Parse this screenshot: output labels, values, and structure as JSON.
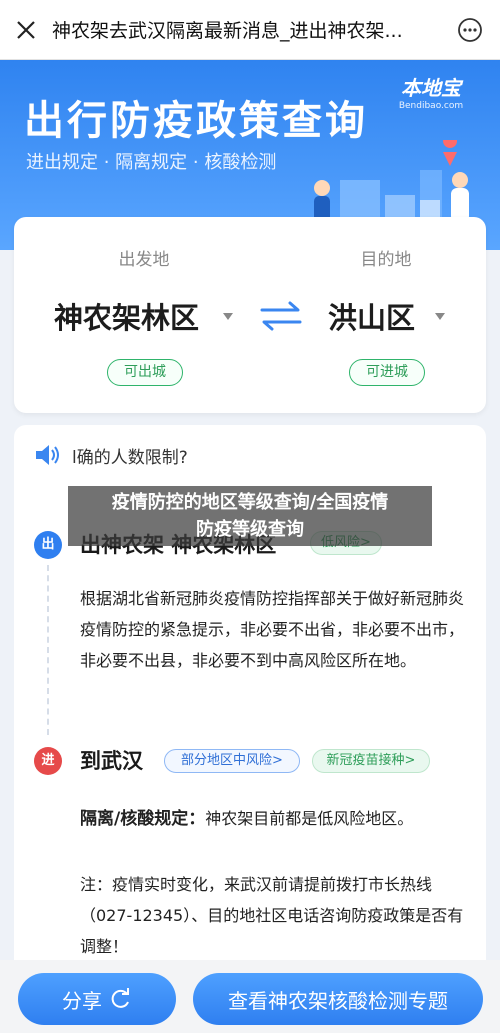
{
  "topbar": {
    "title": "神农架去武汉隔离最新消息_进出神农架..."
  },
  "hero": {
    "heading": "出行防疫政策查询",
    "subheading": "进出规定 · 隔离规定 · 核酸检测",
    "brand_cn": "本地宝",
    "brand_en": "Bendibao.com"
  },
  "route": {
    "from_label": "出发地",
    "to_label": "目的地",
    "from_city": "神农架林区",
    "to_city": "洪山区",
    "from_status": "可出城",
    "to_status": "可进城"
  },
  "notice": {
    "text": "l确的人数限制?"
  },
  "overlay": {
    "line1": "疫情防控的地区等级查询/全国疫情",
    "line2": "防疫等级查询"
  },
  "exit": {
    "badge": "出",
    "title": "出神农架 神农架林区",
    "risk_tag": "低风险>",
    "body": "根据湖北省新冠肺炎疫情防控指挥部关于做好新冠肺炎疫情防控的紧急提示，非必要不出省，非必要不出市，非必要不出县，非必要不到中高风险区所在地。"
  },
  "entry": {
    "badge": "进",
    "title": "到武汉",
    "risk_tag": "部分地区中风险>",
    "vaccine_tag": "新冠疫苗接种>",
    "quarantine_label": "隔离/核酸规定：",
    "quarantine_text": "神农架目前都是低风险地区。",
    "note": "注：疫情实时变化，来武汉前请提前拨打市长热线（027-12345）、目的地社区电话咨询防疫政策是否有调整！"
  },
  "bottom": {
    "share_label": "分享",
    "check_label": "查看神农架核酸检测专题"
  },
  "colors": {
    "brand_blue": "#2f83f0",
    "green": "#2fb46b",
    "exit_badge": "#2f7ff0",
    "entry_badge": "#e64a4a"
  }
}
